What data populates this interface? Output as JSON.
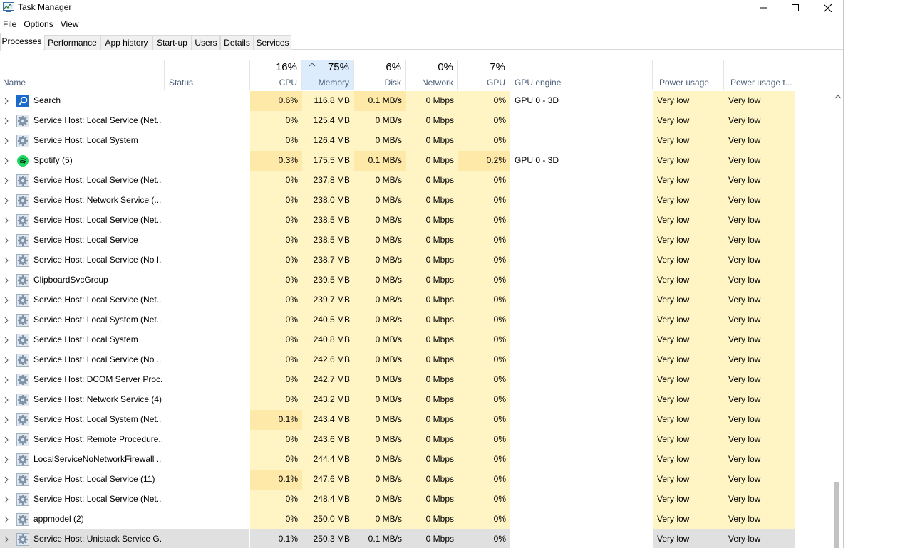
{
  "window": {
    "title": "Task Manager"
  },
  "menu": [
    "File",
    "Options",
    "View"
  ],
  "tabs": [
    "Processes",
    "Performance",
    "App history",
    "Start-up",
    "Users",
    "Details",
    "Services"
  ],
  "columns": {
    "name": "Name",
    "status": "Status",
    "cpu": {
      "pct": "16%",
      "label": "CPU"
    },
    "memory": {
      "pct": "75%",
      "label": "Memory"
    },
    "disk": {
      "pct": "6%",
      "label": "Disk"
    },
    "network": {
      "pct": "0%",
      "label": "Network"
    },
    "gpu": {
      "pct": "7%",
      "label": "GPU"
    },
    "gpu_engine": "GPU engine",
    "power": "Power usage",
    "power_trend": "Power usage t..."
  },
  "colors": {
    "heat_low": "#fff4c4",
    "heat_mid": "#ffe9a8",
    "selected": "#e0e0e0",
    "sorted_header": "#dcecfc",
    "header_label": "#4c607a"
  },
  "rows": [
    {
      "name": "Search",
      "icon": "search",
      "cpu": "0.6%",
      "memory": "116.8 MB",
      "disk": "0.1 MB/s",
      "network": "0 Mbps",
      "gpu": "0%",
      "gpu_engine": "GPU 0 - 3D",
      "power": "Very low",
      "power_trend": "Very low"
    },
    {
      "name": "Service Host: Local Service (Net...",
      "icon": "gear",
      "cpu": "0%",
      "memory": "125.4 MB",
      "disk": "0 MB/s",
      "network": "0 Mbps",
      "gpu": "0%",
      "gpu_engine": "",
      "power": "Very low",
      "power_trend": "Very low"
    },
    {
      "name": "Service Host: Local System",
      "icon": "gear",
      "cpu": "0%",
      "memory": "126.4 MB",
      "disk": "0 MB/s",
      "network": "0 Mbps",
      "gpu": "0%",
      "gpu_engine": "",
      "power": "Very low",
      "power_trend": "Very low"
    },
    {
      "name": "Spotify (5)",
      "icon": "spotify",
      "cpu": "0.3%",
      "memory": "175.5 MB",
      "disk": "0.1 MB/s",
      "network": "0 Mbps",
      "gpu": "0.2%",
      "gpu_engine": "GPU 0 - 3D",
      "power": "Very low",
      "power_trend": "Very low"
    },
    {
      "name": "Service Host: Local Service (Net...",
      "icon": "gear",
      "cpu": "0%",
      "memory": "237.8 MB",
      "disk": "0 MB/s",
      "network": "0 Mbps",
      "gpu": "0%",
      "gpu_engine": "",
      "power": "Very low",
      "power_trend": "Very low"
    },
    {
      "name": "Service Host: Network Service (...",
      "icon": "gear",
      "cpu": "0%",
      "memory": "238.0 MB",
      "disk": "0 MB/s",
      "network": "0 Mbps",
      "gpu": "0%",
      "gpu_engine": "",
      "power": "Very low",
      "power_trend": "Very low"
    },
    {
      "name": "Service Host: Local Service (Net...",
      "icon": "gear",
      "cpu": "0%",
      "memory": "238.5 MB",
      "disk": "0 MB/s",
      "network": "0 Mbps",
      "gpu": "0%",
      "gpu_engine": "",
      "power": "Very low",
      "power_trend": "Very low"
    },
    {
      "name": "Service Host: Local Service",
      "icon": "gear",
      "cpu": "0%",
      "memory": "238.5 MB",
      "disk": "0 MB/s",
      "network": "0 Mbps",
      "gpu": "0%",
      "gpu_engine": "",
      "power": "Very low",
      "power_trend": "Very low"
    },
    {
      "name": "Service Host: Local Service (No I...",
      "icon": "gear",
      "cpu": "0%",
      "memory": "238.7 MB",
      "disk": "0 MB/s",
      "network": "0 Mbps",
      "gpu": "0%",
      "gpu_engine": "",
      "power": "Very low",
      "power_trend": "Very low"
    },
    {
      "name": "ClipboardSvcGroup",
      "icon": "gear",
      "cpu": "0%",
      "memory": "239.5 MB",
      "disk": "0 MB/s",
      "network": "0 Mbps",
      "gpu": "0%",
      "gpu_engine": "",
      "power": "Very low",
      "power_trend": "Very low"
    },
    {
      "name": "Service Host: Local Service (Net...",
      "icon": "gear",
      "cpu": "0%",
      "memory": "239.7 MB",
      "disk": "0 MB/s",
      "network": "0 Mbps",
      "gpu": "0%",
      "gpu_engine": "",
      "power": "Very low",
      "power_trend": "Very low"
    },
    {
      "name": "Service Host: Local System (Net...",
      "icon": "gear",
      "cpu": "0%",
      "memory": "240.5 MB",
      "disk": "0 MB/s",
      "network": "0 Mbps",
      "gpu": "0%",
      "gpu_engine": "",
      "power": "Very low",
      "power_trend": "Very low"
    },
    {
      "name": "Service Host: Local System",
      "icon": "gear",
      "cpu": "0%",
      "memory": "240.8 MB",
      "disk": "0 MB/s",
      "network": "0 Mbps",
      "gpu": "0%",
      "gpu_engine": "",
      "power": "Very low",
      "power_trend": "Very low"
    },
    {
      "name": "Service Host: Local Service (No ...",
      "icon": "gear",
      "cpu": "0%",
      "memory": "242.6 MB",
      "disk": "0 MB/s",
      "network": "0 Mbps",
      "gpu": "0%",
      "gpu_engine": "",
      "power": "Very low",
      "power_trend": "Very low"
    },
    {
      "name": "Service Host: DCOM Server Proc...",
      "icon": "gear",
      "cpu": "0%",
      "memory": "242.7 MB",
      "disk": "0 MB/s",
      "network": "0 Mbps",
      "gpu": "0%",
      "gpu_engine": "",
      "power": "Very low",
      "power_trend": "Very low"
    },
    {
      "name": "Service Host: Network Service (4)",
      "icon": "gear",
      "cpu": "0%",
      "memory": "243.2 MB",
      "disk": "0 MB/s",
      "network": "0 Mbps",
      "gpu": "0%",
      "gpu_engine": "",
      "power": "Very low",
      "power_trend": "Very low"
    },
    {
      "name": "Service Host: Local System (Net...",
      "icon": "gear",
      "cpu": "0.1%",
      "memory": "243.4 MB",
      "disk": "0 MB/s",
      "network": "0 Mbps",
      "gpu": "0%",
      "gpu_engine": "",
      "power": "Very low",
      "power_trend": "Very low"
    },
    {
      "name": "Service Host: Remote Procedure...",
      "icon": "gear",
      "cpu": "0%",
      "memory": "243.6 MB",
      "disk": "0 MB/s",
      "network": "0 Mbps",
      "gpu": "0%",
      "gpu_engine": "",
      "power": "Very low",
      "power_trend": "Very low"
    },
    {
      "name": "LocalServiceNoNetworkFirewall ...",
      "icon": "gear",
      "cpu": "0%",
      "memory": "244.4 MB",
      "disk": "0 MB/s",
      "network": "0 Mbps",
      "gpu": "0%",
      "gpu_engine": "",
      "power": "Very low",
      "power_trend": "Very low"
    },
    {
      "name": "Service Host: Local Service (11)",
      "icon": "gear",
      "cpu": "0.1%",
      "memory": "247.6 MB",
      "disk": "0 MB/s",
      "network": "0 Mbps",
      "gpu": "0%",
      "gpu_engine": "",
      "power": "Very low",
      "power_trend": "Very low"
    },
    {
      "name": "Service Host: Local Service (Net...",
      "icon": "gear",
      "cpu": "0%",
      "memory": "248.4 MB",
      "disk": "0 MB/s",
      "network": "0 Mbps",
      "gpu": "0%",
      "gpu_engine": "",
      "power": "Very low",
      "power_trend": "Very low"
    },
    {
      "name": "appmodel (2)",
      "icon": "gear",
      "cpu": "0%",
      "memory": "250.0 MB",
      "disk": "0 MB/s",
      "network": "0 Mbps",
      "gpu": "0%",
      "gpu_engine": "",
      "power": "Very low",
      "power_trend": "Very low"
    },
    {
      "name": "Service Host: Unistack Service G...",
      "icon": "gear",
      "cpu": "0.1%",
      "memory": "250.3 MB",
      "disk": "0.1 MB/s",
      "network": "0 Mbps",
      "gpu": "0%",
      "gpu_engine": "",
      "power": "Very low",
      "power_trend": "Very low",
      "selected": true
    }
  ]
}
